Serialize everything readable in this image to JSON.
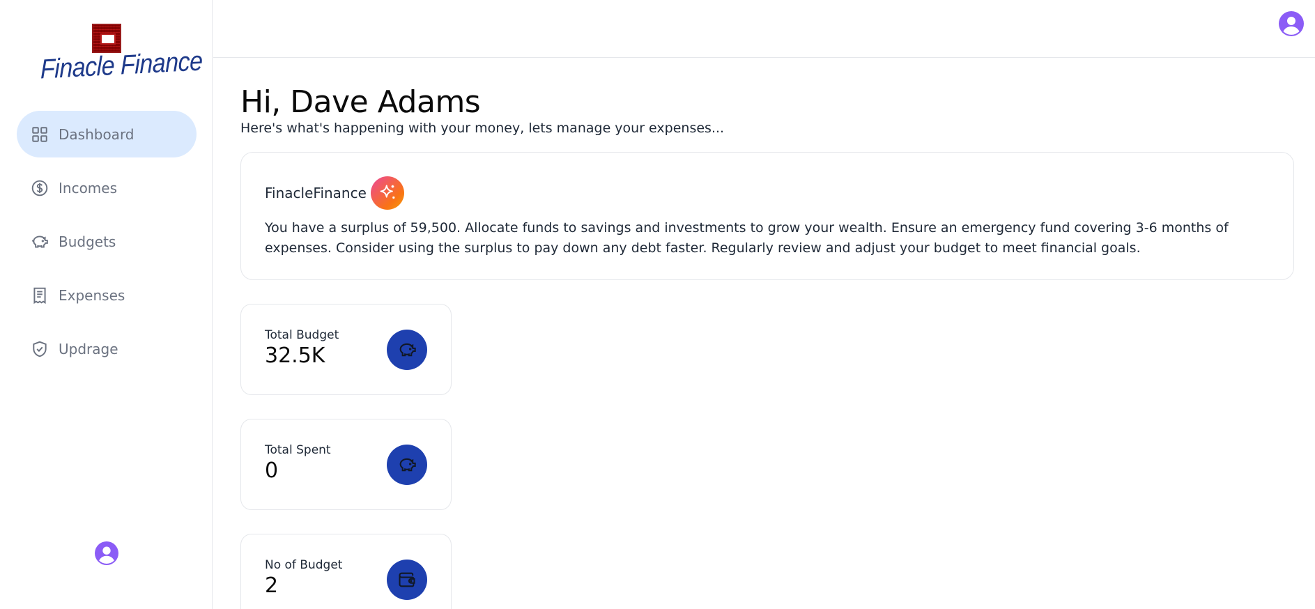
{
  "app": {
    "logo_text": "Finacle Finance"
  },
  "sidebar": {
    "items": [
      {
        "label": "Dashboard",
        "icon": "dashboard-grid-icon",
        "active": true
      },
      {
        "label": "Incomes",
        "icon": "dollar-circle-icon",
        "active": false
      },
      {
        "label": "Budgets",
        "icon": "piggy-bank-icon",
        "active": false
      },
      {
        "label": "Expenses",
        "icon": "receipt-icon",
        "active": false
      },
      {
        "label": "Updrage",
        "icon": "shield-check-icon",
        "active": false
      }
    ]
  },
  "header": {
    "greeting": "Hi, Dave Adams",
    "subtitle": "Here's what's happening with your money, lets manage your expenses..."
  },
  "ai_card": {
    "brand": "FinacleFinance",
    "icon": "sparkles-icon",
    "message": "You have a surplus of 59,500. Allocate funds to savings and investments to grow your wealth. Ensure an emergency fund covering 3-6 months of expenses. Consider using the surplus to pay down any debt faster. Regularly review and adjust your budget to meet financial goals."
  },
  "stats": [
    {
      "label": "Total Budget",
      "value": "32.5K",
      "icon": "piggy-bank-icon"
    },
    {
      "label": "Total Spent",
      "value": "0",
      "icon": "piggy-bank-icon"
    },
    {
      "label": "No of Budget",
      "value": "2",
      "icon": "wallet-icon"
    }
  ],
  "colors": {
    "active_nav_bg": "#dbeafe",
    "stat_icon_bg": "#1e40af",
    "brand_blue": "#1e3a8a",
    "logo_red": "#b91c1c",
    "avatar_purple": "#8b5cf6"
  }
}
